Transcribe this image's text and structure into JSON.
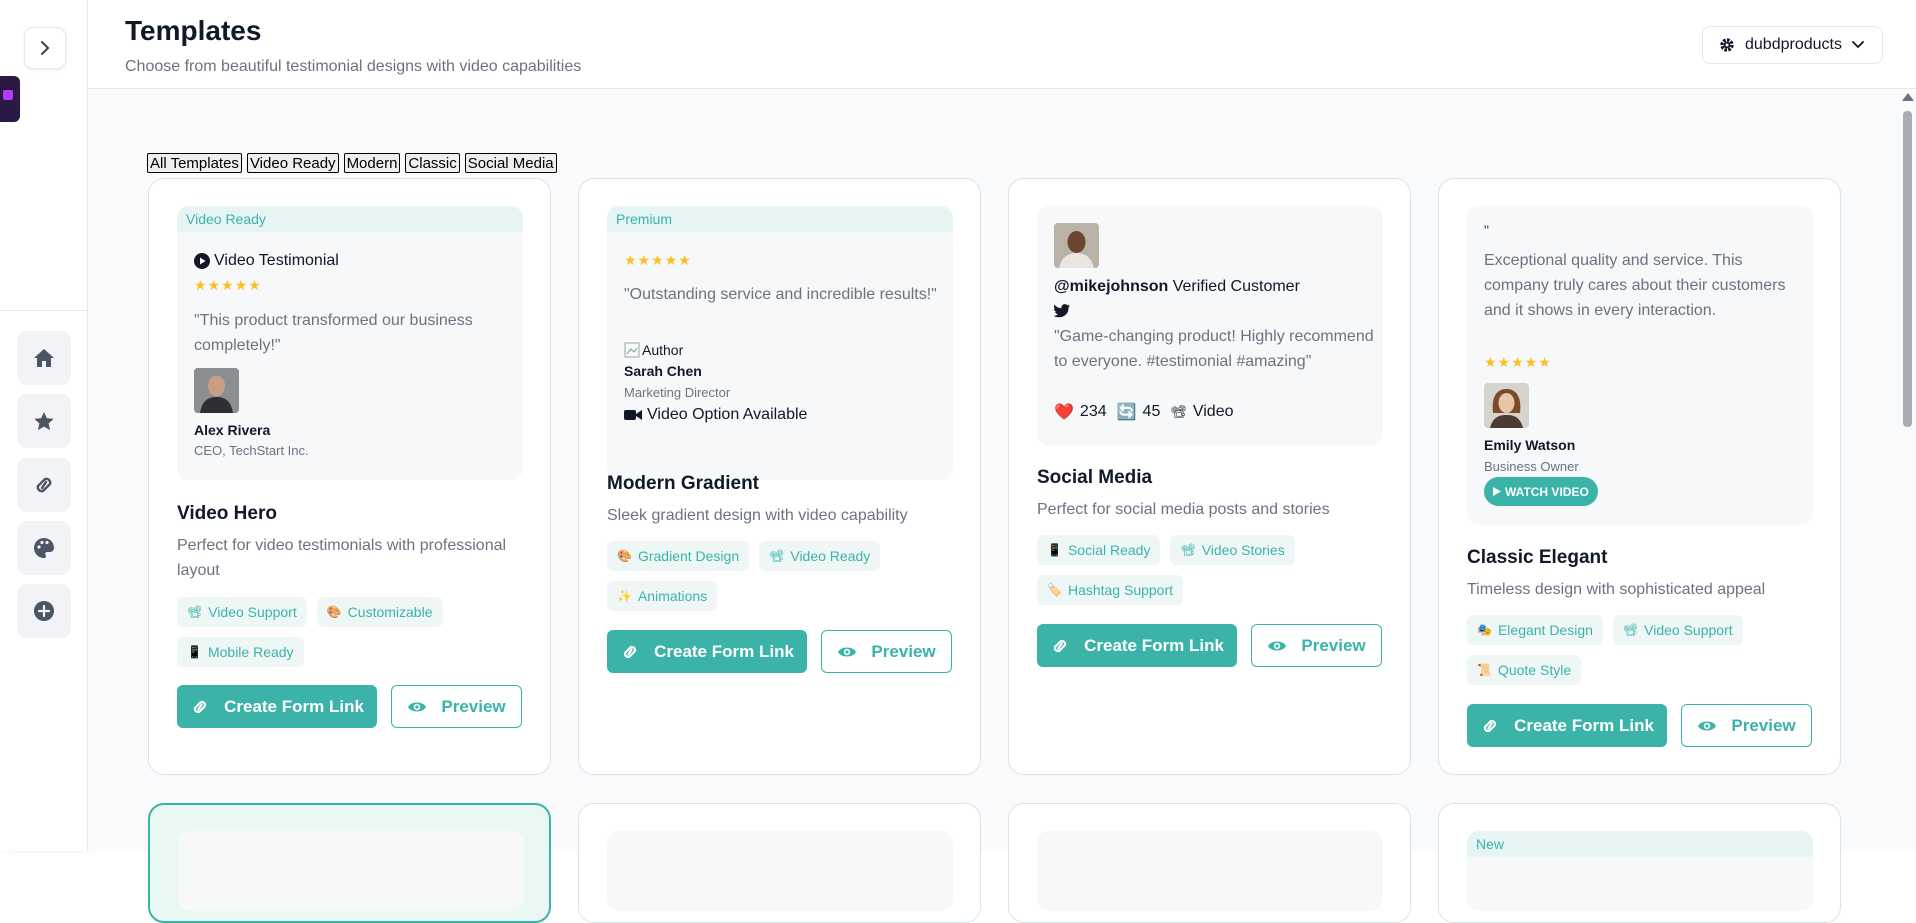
{
  "header": {
    "title": "Templates",
    "subtitle": "Choose from beautiful testimonial designs with video capabilities",
    "account_name": "dubdproducts"
  },
  "sidebar": {
    "items": [
      {
        "icon": "home-icon"
      },
      {
        "icon": "star-icon"
      },
      {
        "icon": "link-icon"
      },
      {
        "icon": "palette-icon"
      },
      {
        "icon": "plus-circle-icon"
      }
    ]
  },
  "filters": [
    "All Templates",
    "Video Ready",
    "Modern",
    "Classic",
    "Social Media"
  ],
  "actions": {
    "create_label": "Create Form Link",
    "preview_label": "Preview"
  },
  "cards": [
    {
      "badge": "Video Ready",
      "video_label": "Video Testimonial",
      "stars": "★★★★★",
      "quote": "\"This product transformed our business completely!\"",
      "author": "Alex Rivera",
      "role": "CEO, TechStart Inc.",
      "name": "Video Hero",
      "description": "Perfect for video testimonials with professional layout",
      "tags": [
        "Video Support",
        "Customizable",
        "Mobile Ready"
      ]
    },
    {
      "badge": "Premium",
      "stars": "★★★★★",
      "quote": "\"Outstanding service and incredible results!\"",
      "img_alt": "Author",
      "author": "Sarah Chen",
      "role": "Marketing Director",
      "video_option": "Video Option Available",
      "name": "Modern Gradient",
      "description": "Sleek gradient design with video capability",
      "tags": [
        "Gradient Design",
        "Video Ready",
        "Animations"
      ]
    },
    {
      "handle": "@mikejohnson",
      "verified": "Verified Customer",
      "quote": "\"Game-changing product! Highly recommend to everyone. #testimonial #amazing\"",
      "likes": "234",
      "shares": "45",
      "video": "Video",
      "name": "Social Media",
      "description": "Perfect for social media posts and stories",
      "tags": [
        "Social Ready",
        "Video Stories",
        "Hashtag Support"
      ]
    },
    {
      "open_quote": "\"",
      "quote": "Exceptional quality and service. This company truly cares about their customers and it shows in every interaction.",
      "stars": "★★★★★",
      "author": "Emily Watson",
      "role": "Business Owner",
      "watch_label": "WATCH VIDEO",
      "name": "Classic Elegant",
      "description": "Timeless design with sophisticated appeal",
      "tags": [
        "Elegant Design",
        "Video Support",
        "Quote Style"
      ]
    }
  ],
  "next_row": {
    "badge": "New"
  }
}
